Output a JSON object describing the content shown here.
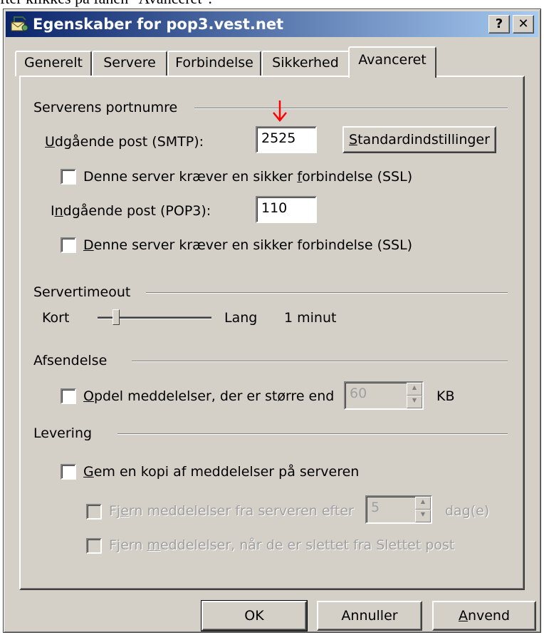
{
  "caption": "fter klikkes på fanen \"Avanceret\".",
  "window": {
    "title": "Egenskaber for pop3.vest.net",
    "help_glyph": "?",
    "close_glyph": "✕",
    "icon": "mail-account-icon"
  },
  "tabs": [
    {
      "label": "Generelt",
      "active": false
    },
    {
      "label": "Servere",
      "active": false
    },
    {
      "label": "Forbindelse",
      "active": false
    },
    {
      "label": "Sikkerhed",
      "active": false
    },
    {
      "label": "Avanceret",
      "active": true
    }
  ],
  "ports": {
    "group_label": "Serverens portnumre",
    "smtp_label_u": "U",
    "smtp_label_rest": "dgående post (SMTP):",
    "smtp_value": "2525",
    "defaults_button_u": "S",
    "defaults_button_rest": "tandardindstillinger",
    "ssl_smtp_pre": "Denne server kræver en sikker ",
    "ssl_smtp_u": "f",
    "ssl_smtp_post": "orbindelse (SSL)",
    "ssl_smtp_checked": false,
    "pop3_label_pre": "I",
    "pop3_label_u": "n",
    "pop3_label_post": "dgående post (POP3):",
    "pop3_value": "110",
    "ssl_pop3_u": "D",
    "ssl_pop3_rest": "enne server kræver en sikker forbindelse (SSL)",
    "ssl_pop3_checked": false,
    "arrow_color": "#ff0000"
  },
  "timeout": {
    "group_label": "Servertimeout",
    "min_label": "Kort",
    "max_label": "Lang",
    "value_text": "1 minut",
    "slider_level": 0.14
  },
  "sending": {
    "group_label": "Afsendelse",
    "split_u": "O",
    "split_rest": "pdel meddelelser, der er større end",
    "split_checked": false,
    "split_value": "60",
    "split_unit": "KB"
  },
  "delivery": {
    "group_label": "Levering",
    "keep_u": "G",
    "keep_rest": "em en kopi af meddelelser på serveren",
    "keep_checked": false,
    "remove_after_pre": "Fj",
    "remove_after_u": "e",
    "remove_after_post": "rn meddelelser fra serveren efter",
    "remove_after_value": "5",
    "remove_after_unit": "dag(e)",
    "remove_deleted_pre": "Fjern ",
    "remove_deleted_u": "m",
    "remove_deleted_post": "eddelelser, når de er slettet fra Slettet post"
  },
  "buttons": {
    "ok": "OK",
    "cancel": "Annuller",
    "apply_u": "A",
    "apply_rest": "nvend"
  },
  "colors": {
    "face": "#d4d0c8",
    "title_start": "#0a246a",
    "title_end": "#a6caf0"
  }
}
